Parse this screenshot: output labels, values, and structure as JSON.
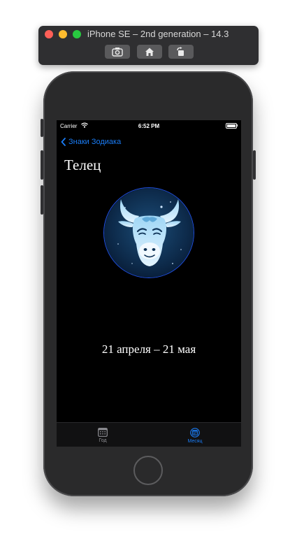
{
  "simulator": {
    "title": "iPhone SE – 2nd generation – 14.3",
    "buttons": [
      "screenshot-icon",
      "home-icon",
      "rotate-icon"
    ]
  },
  "status_bar": {
    "carrier": "Carrier",
    "time": "6:52 PM",
    "battery_level": 1.0
  },
  "nav": {
    "back_label": "Знаки Зодиака"
  },
  "sign": {
    "name": "Телец",
    "image_icon": "taurus-bull-icon",
    "date_range": "21 апреля – 21 мая"
  },
  "tab_bar": {
    "tabs": [
      {
        "label": "Год",
        "icon": "calendar-grid-icon",
        "selected": false
      },
      {
        "label": "Месяц",
        "icon": "calendar-circle-icon",
        "selected": true
      }
    ]
  },
  "colors": {
    "accent": "#1a7cf5",
    "screen_background": "#000000",
    "image_ring": "#1f4fe0",
    "bull_glow": "#9fd6f5"
  }
}
